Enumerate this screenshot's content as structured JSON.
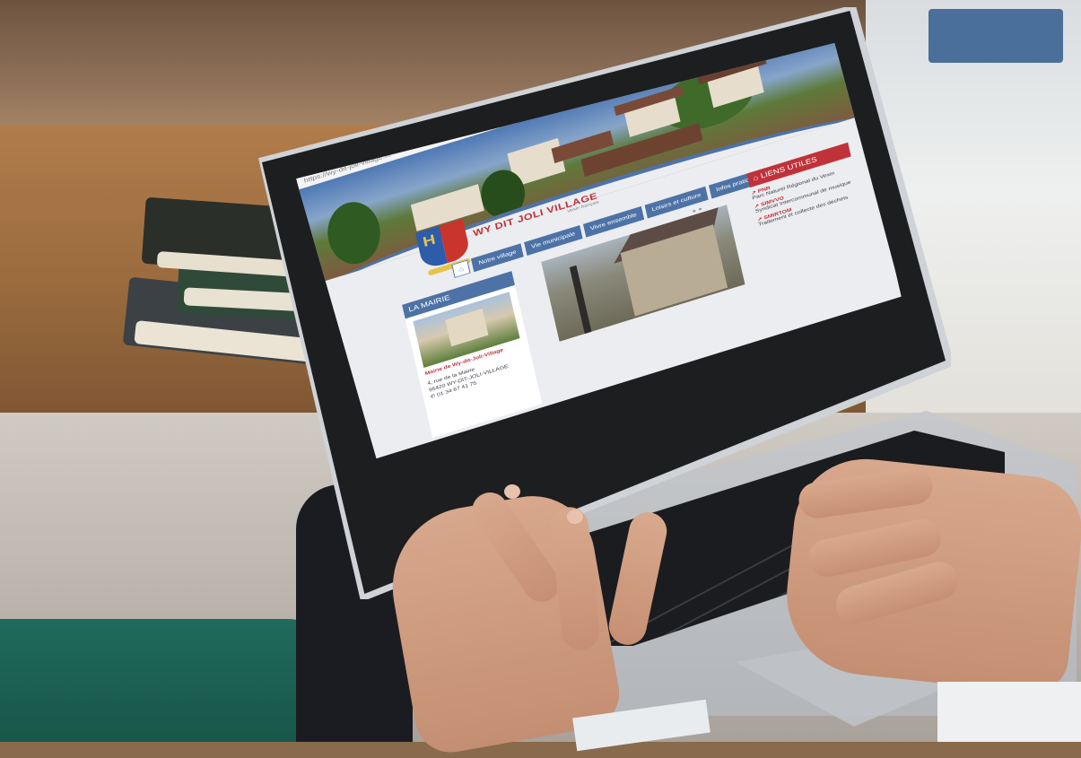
{
  "browser": {
    "url": "https://wy-dit-joli-village.fr/"
  },
  "site": {
    "brand_top": "Commune de",
    "brand_title": "WY DIT JOLI VILLAGE",
    "brand_sub": "Vexin français"
  },
  "nav": {
    "home_icon": "home-icon",
    "items": [
      {
        "label": "Notre village"
      },
      {
        "label": "Vie municipale"
      },
      {
        "label": "Vivre ensemble"
      },
      {
        "label": "Loisirs et culture"
      },
      {
        "label": "Infos pratiques"
      }
    ]
  },
  "mairie": {
    "title": "LA MAIRIE",
    "name": "Mairie de Wy-dit-Joli-Village",
    "address_line1": "4, rue de la Mairie",
    "address_line2": "95420 WY-DIT-JOLI-VILLAGE",
    "phone": "01 34 67 41 75"
  },
  "links": {
    "title": "LIENS UTILES",
    "items": [
      {
        "name": "PNR",
        "desc": "Parc Naturel Régional du Vexin"
      },
      {
        "name": "SIMVVO",
        "desc": "Syndicat Intercommunal de musique"
      },
      {
        "name": "SMIRTOM",
        "desc": "Traitement et collecte des déchets"
      }
    ]
  },
  "colors": {
    "accent_blue": "#4d72a6",
    "accent_red": "#c0323a"
  }
}
